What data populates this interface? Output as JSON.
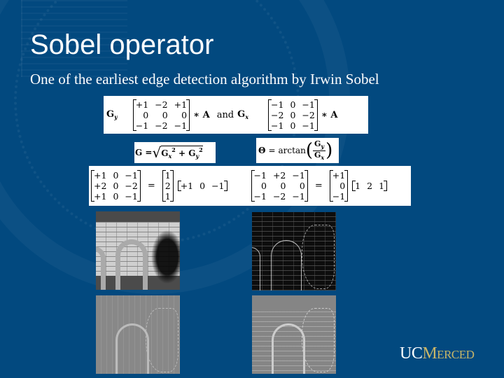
{
  "slide": {
    "title": "Sobel operator",
    "subtitle": "One of the earliest edge detection algorithm by Irwin Sobel",
    "background_color": "#02497f"
  },
  "equations": {
    "kernels": {
      "gy_label": "G",
      "gy_sub": "y",
      "gy_matrix": [
        "+1",
        "−2",
        "+1",
        "0",
        "0",
        "0",
        "−1",
        "−2",
        "−1"
      ],
      "conv_a": "∗ A",
      "and": "and",
      "gx_label": "G",
      "gx_sub": "x",
      "gx_matrix": [
        "−1",
        "0",
        "−1",
        "−2",
        "0",
        "−2",
        "−1",
        "0",
        "−1"
      ]
    },
    "magnitude": {
      "lhs": "G = ",
      "sqrt": "√",
      "term1": "G",
      "term1_sub": "x",
      "plus": " + ",
      "term2": "G",
      "term2_sub": "y",
      "pow": "2"
    },
    "direction": {
      "theta": "Θ",
      "equals": " = ",
      "arctan": "arctan",
      "num": "G",
      "num_sub": "y",
      "den": "G",
      "den_sub": "x"
    },
    "separable": {
      "left_matrix": [
        "+1",
        "0",
        "−1",
        "+2",
        "0",
        "−2",
        "+1",
        "0",
        "−1"
      ],
      "left_eq": "=",
      "left_col": [
        "1",
        "2",
        "1"
      ],
      "left_row": [
        "+1",
        "0",
        "−1"
      ],
      "right_matrix": [
        "−1",
        "+2",
        "−1",
        "0",
        "0",
        "0",
        "−1",
        "−2",
        "−1"
      ],
      "right_eq": "=",
      "right_col": [
        "+1",
        "0",
        "−1"
      ],
      "right_row": [
        "1",
        "2",
        "1"
      ]
    }
  },
  "images": [
    {
      "label": "original grayscale photo of bike rack"
    },
    {
      "label": "gradient magnitude edge image"
    },
    {
      "label": "horizontal gradient Gx image"
    },
    {
      "label": "vertical gradient Gy image"
    }
  ],
  "logo": {
    "uc": "UC",
    "merced": "Merced",
    "uc_color": "#ffffff",
    "merced_color": "#c8b568"
  }
}
